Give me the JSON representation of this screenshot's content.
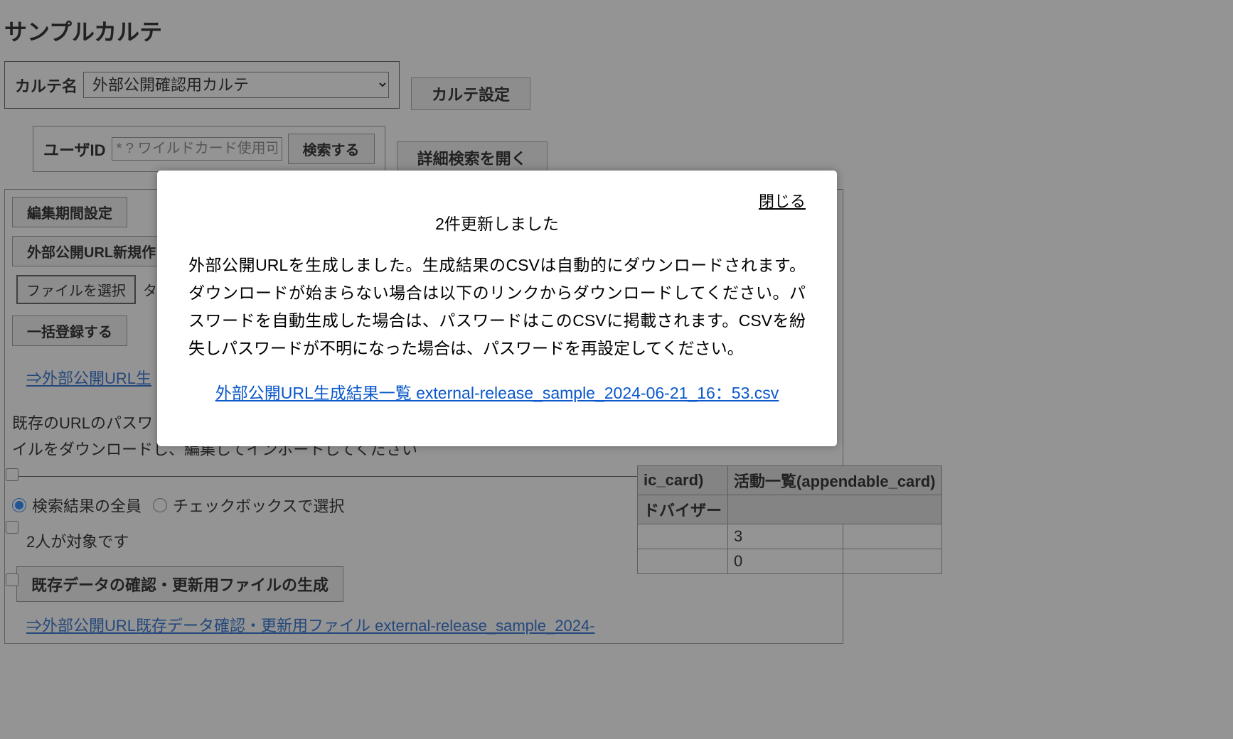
{
  "page": {
    "title": "サンプルカルテ"
  },
  "karteBar": {
    "label": "カルテ名",
    "selected": "外部公開確認用カルテ",
    "settingsBtn": "カルテ設定"
  },
  "search": {
    "userIdLabel": "ユーザID",
    "placeholder": "* ? ワイルドカード使用可",
    "searchBtn": "検索する",
    "advancedBtn": "詳細検索を開く"
  },
  "panel": {
    "editPeriodBtn": "編集期間設定",
    "newUrlBtn": "外部公開URL新規作",
    "fileSelectBtn": "ファイルを選択",
    "fileStatusPartial": "タ",
    "bulkRegisterBtn": "一括登録する",
    "genResultLinkPartial": "⇒外部公開URL生",
    "instructionLine1": "既存のURLのパスワ",
    "instructionLine2": "イルをダウンロードし、編集してインポートしてください",
    "radioAll": "検索結果の全員",
    "radioChecked": "チェックボックスで選択",
    "countText": "2人が対象です",
    "genFileBtn": "既存データの確認・更新用ファイルの生成",
    "bottomLink": "⇒外部公開URL既存データ確認・更新用ファイル  external-release_sample_2024-"
  },
  "table": {
    "header1_partial": "ic_card)",
    "header2": "活動一覧(appendable_card)",
    "subhead_partial": "ドバイザー",
    "rows": [
      {
        "col2": "3"
      },
      {
        "col2": "0"
      }
    ]
  },
  "modal": {
    "close": "閉じる",
    "title": "2件更新しました",
    "body": "外部公開URLを生成しました。生成結果のCSVは自動的にダウンロードされます。ダウンロードが始まらない場合は以下のリンクからダウンロードしてください。パスワードを自動生成した場合は、パスワードはこのCSVに掲載されます。CSVを紛失しパスワードが不明になった場合は、パスワードを再設定してください。",
    "link": "外部公開URL生成結果一覧  external-release_sample_2024-06-21_16：53.csv"
  }
}
